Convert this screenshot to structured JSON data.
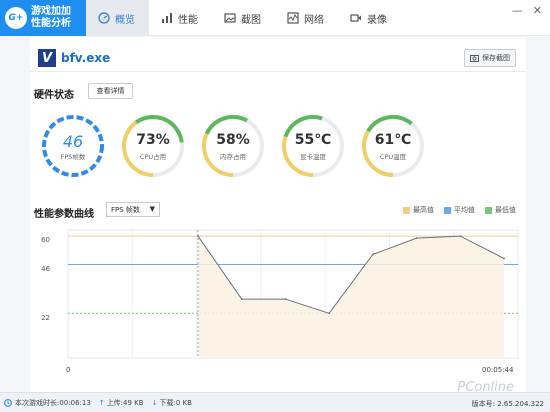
{
  "app": {
    "logo_mark": "G+",
    "logo_line1": "游戏加加",
    "logo_line2": "性能分析"
  },
  "tabs": [
    {
      "label": "概览",
      "icon": "overview-icon",
      "active": true
    },
    {
      "label": "性能",
      "icon": "bar-chart-icon",
      "active": false
    },
    {
      "label": "截图",
      "icon": "image-icon",
      "active": false
    },
    {
      "label": "网络",
      "icon": "network-icon",
      "active": false
    },
    {
      "label": "录像",
      "icon": "video-icon",
      "active": false
    }
  ],
  "window": {
    "minimize": "—",
    "close": "✕"
  },
  "process": {
    "icon_letter": "V",
    "name": "bfv.exe"
  },
  "screenshot_button": "保存截图",
  "hardware": {
    "title": "硬件状态",
    "detail_button": "查看详情",
    "gauges": [
      {
        "value": "46",
        "label": "FPS帧数",
        "percent": null,
        "color": "#2f8be5"
      },
      {
        "value": "73%",
        "label": "CPU占用",
        "percent": 73,
        "color": "#5cb85c"
      },
      {
        "value": "58%",
        "label": "内存占用",
        "percent": 58,
        "color": "#5cb85c"
      },
      {
        "value": "55℃",
        "label": "显卡温度",
        "percent": 55,
        "color": "#5cb85c"
      },
      {
        "value": "61℃",
        "label": "CPU温度",
        "percent": 61,
        "color": "#5cb85c"
      }
    ]
  },
  "curve": {
    "title": "性能参数曲线",
    "select_value": "FPS 帧数",
    "legend": [
      {
        "label": "最高值",
        "color": "#f0cf8e"
      },
      {
        "label": "平均值",
        "color": "#6fa8e0"
      },
      {
        "label": "最低值",
        "color": "#7cc47a"
      }
    ]
  },
  "chart_data": {
    "type": "line",
    "yticks": [
      "60",
      "46",
      "22"
    ],
    "max_value": 60,
    "avg_value": 46,
    "min_value": 22,
    "ylim": [
      0,
      60
    ],
    "x_start_label": "0",
    "x_end_label": "00:05:44",
    "x": [
      0,
      1,
      2,
      3,
      4,
      5,
      6,
      7
    ],
    "values": [
      60,
      29,
      29,
      22,
      51,
      59,
      60,
      49
    ]
  },
  "status": {
    "play_time_label": "本次游戏时长:",
    "play_time_value": "00:06:13",
    "upload_label": "上传:",
    "upload_value": "49 KB",
    "download_label": "下载:",
    "download_value": "0 KB",
    "version_label": "版本号:",
    "version_value": "2.65.204.322"
  },
  "watermark": "PConline"
}
